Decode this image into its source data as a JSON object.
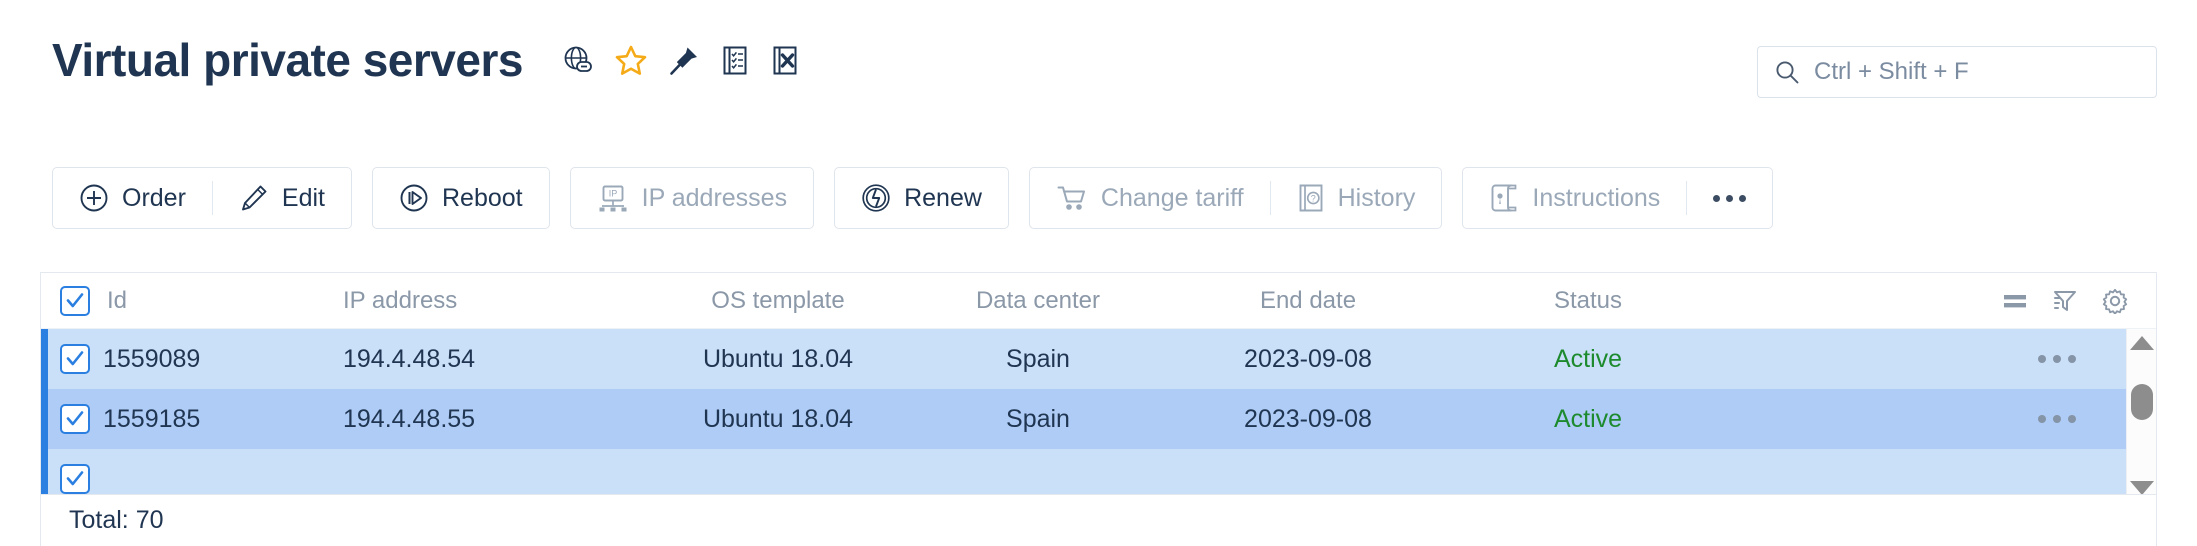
{
  "header": {
    "title": "Virtual private servers",
    "icons": [
      {
        "name": "globe-link-icon",
        "label": "Open site"
      },
      {
        "name": "star-icon",
        "label": "Favorite"
      },
      {
        "name": "pin-icon",
        "label": "Pin"
      },
      {
        "name": "checklist-report-icon",
        "label": "Report"
      },
      {
        "name": "excel-export-icon",
        "label": "Export to Excel"
      }
    ]
  },
  "search": {
    "placeholder": "Ctrl + Shift + F",
    "value": "",
    "icon": "search-icon"
  },
  "toolbar": {
    "groups": [
      {
        "buttons": [
          {
            "label": "Order",
            "icon": "plus-circle-icon",
            "disabled": false
          },
          {
            "label": "Edit",
            "icon": "pencil-icon",
            "disabled": false
          }
        ]
      },
      {
        "buttons": [
          {
            "label": "Reboot",
            "icon": "reboot-icon",
            "disabled": false
          }
        ]
      },
      {
        "buttons": [
          {
            "label": "IP addresses",
            "icon": "ip-monitor-icon",
            "disabled": true
          }
        ]
      },
      {
        "buttons": [
          {
            "label": "Renew",
            "icon": "renew-icon",
            "disabled": false
          }
        ]
      },
      {
        "buttons": [
          {
            "label": "Change tariff",
            "icon": "cart-icon",
            "disabled": true
          },
          {
            "label": "History",
            "icon": "book-question-icon",
            "disabled": true
          }
        ]
      },
      {
        "buttons": [
          {
            "label": "Instructions",
            "icon": "scroll-key-icon",
            "disabled": true
          },
          {
            "label": "",
            "icon": "more-dots-icon",
            "disabled": false
          }
        ]
      }
    ]
  },
  "table": {
    "select_all_checked": true,
    "columns": [
      {
        "key": "id",
        "label": "Id"
      },
      {
        "key": "ip",
        "label": "IP address"
      },
      {
        "key": "os",
        "label": "OS template"
      },
      {
        "key": "dc",
        "label": "Data center"
      },
      {
        "key": "end",
        "label": "End date"
      },
      {
        "key": "status",
        "label": "Status"
      }
    ],
    "header_icons": [
      {
        "name": "row-density-icon"
      },
      {
        "name": "filter-sort-icon"
      },
      {
        "name": "gear-icon"
      }
    ],
    "rows": [
      {
        "checked": true,
        "id": "1559089",
        "ip": "194.4.48.54",
        "os": "Ubuntu 18.04",
        "dc": "Spain",
        "end": "2023-09-08",
        "status": "Active"
      },
      {
        "checked": true,
        "id": "1559185",
        "ip": "194.4.48.55",
        "os": "Ubuntu 18.04",
        "dc": "Spain",
        "end": "2023-09-08",
        "status": "Active"
      },
      {
        "checked": true,
        "id": "",
        "ip": "",
        "os": "",
        "dc": "",
        "end": "",
        "status": ""
      }
    ],
    "scrollbar": {
      "up": "scroll-up-arrow",
      "down": "scroll-down-arrow",
      "thumb": "scroll-thumb"
    }
  },
  "footer": {
    "total": "Total: 70"
  },
  "colors": {
    "accent": "#2a7fe0",
    "title": "#1f3551",
    "row_selected": "#c9e0f8",
    "row_hover": "#aeccf5",
    "status_active": "#1d8a2e",
    "disabled_text": "#9aa8b8",
    "star": "#f5ab18"
  }
}
